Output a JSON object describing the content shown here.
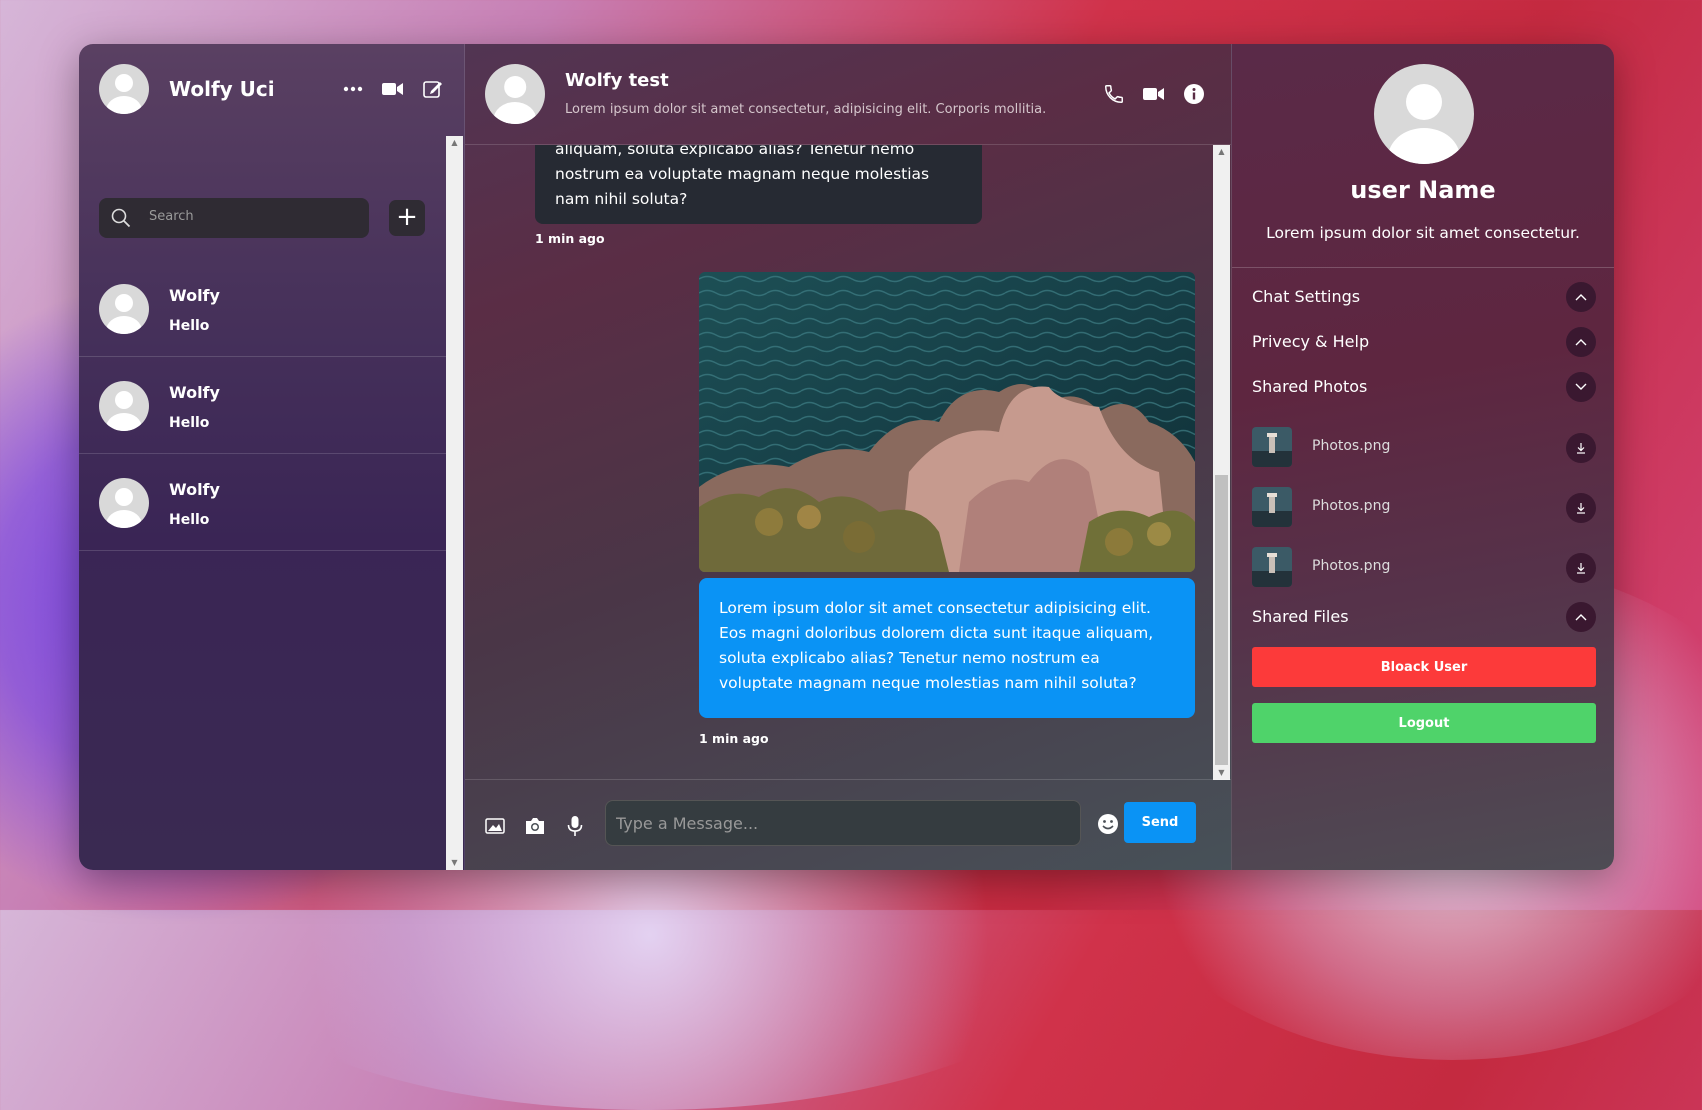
{
  "sidebar": {
    "user_name": "Wolfy Uci",
    "search_placeholder": "Search",
    "contacts": [
      {
        "name": "Wolfy",
        "last_message": "Hello"
      },
      {
        "name": "Wolfy",
        "last_message": "Hello"
      },
      {
        "name": "Wolfy",
        "last_message": "Hello"
      }
    ]
  },
  "chat": {
    "title": "Wolfy test",
    "subtitle": "Lorem ipsum dolor sit amet consectetur, adipisicing elit. Corporis mollitia.",
    "messages": [
      {
        "text": "aliquam, soluta explicabo alias? Tenetur nemo nostrum ea voluptate magnam neque molestias nam nihil soluta?",
        "time": "1 min ago"
      },
      {
        "text": "Lorem ipsum dolor sit amet consectetur adipisicing elit. Eos magni doloribus dolorem dicta sunt itaque aliquam, soluta explicabo alias? Tenetur nemo nostrum ea voluptate magnam neque molestias nam nihil soluta?",
        "time": "1 min ago"
      }
    ],
    "input_placeholder": "Type a Message...",
    "send_label": "Send"
  },
  "profile": {
    "name": "user Name",
    "description": "Lorem ipsum dolor sit amet consectetur.",
    "sections": {
      "chat_settings": "Chat Settings",
      "privacy_help": "Privecy & Help",
      "shared_photos": "Shared Photos",
      "shared_files": "Shared Files"
    },
    "photos": [
      "Photos.png",
      "Photos.png",
      "Photos.png"
    ],
    "block_label": "Bloack User",
    "logout_label": "Logout"
  },
  "colors": {
    "accent": "#0a93f5",
    "danger": "#fc3a3a",
    "success": "#4fd36a"
  }
}
